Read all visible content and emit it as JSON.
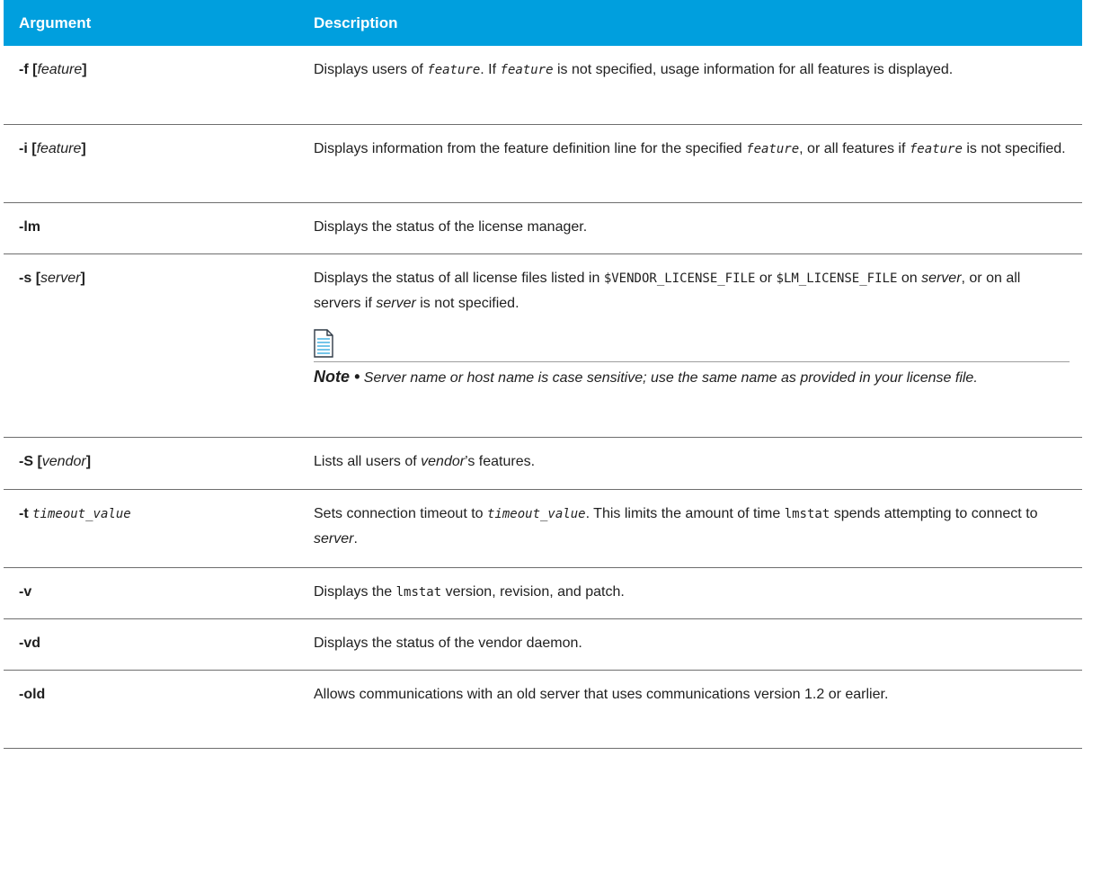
{
  "header": {
    "argument": "Argument",
    "description": "Description"
  },
  "rows": [
    {
      "arg_flag": "-f",
      "arg_open": "[",
      "arg_param": "feature",
      "arg_close": "]",
      "d1": "Displays users of ",
      "d2": "feature",
      "d3": ". If ",
      "d4": "feature",
      "d5": " is not specified, usage information for all features is displayed."
    },
    {
      "arg_flag": "-i",
      "arg_open": "[",
      "arg_param": "feature",
      "arg_close": "]",
      "d1": "Displays information from the feature definition line for the specified ",
      "d2": "feature",
      "d3": ", or all features if ",
      "d4": "feature",
      "d5": " is not specified."
    },
    {
      "arg_flag": "-lm",
      "d1": "Displays the status of the license manager."
    },
    {
      "arg_flag": "-s",
      "arg_open": "[",
      "arg_param": "server",
      "arg_close": "]",
      "d1": "Displays the status of all license files listed in ",
      "d2": "$VENDOR_LICENSE_FILE",
      "d3": " or ",
      "d4": "$LM_LICENSE_FILE",
      "d5": " on ",
      "d6": "server",
      "d7": ", or on all servers if ",
      "d8": "server",
      "d9": " is not specified.",
      "note_label": "Note •",
      "note_text": "Server name or host name is case sensitive; use the same name as provided in your license file."
    },
    {
      "arg_flag": "-S",
      "arg_open": "[",
      "arg_param": "vendor",
      "arg_close": "]",
      "d1": "Lists all users of ",
      "d2": "vendor",
      "d3": "’s features."
    },
    {
      "arg_flag": "-t",
      "arg_param": "timeout_value",
      "d1": "Sets connection timeout to ",
      "d2": "timeout_value",
      "d3": ". This limits the amount of time ",
      "d4": "lmstat",
      "d5": " spends attempting to connect to ",
      "d6": "server",
      "d7": "."
    },
    {
      "arg_flag": "-v",
      "d1": "Displays the ",
      "d2": "lmstat",
      "d3": " version, revision, and patch."
    },
    {
      "arg_flag": "-vd",
      "d1": "Displays the status of the vendor daemon."
    },
    {
      "arg_flag": "-old",
      "d1": "Allows communications with an old server that uses communications version 1.2 or earlier."
    }
  ],
  "icons": {
    "note": "document-note-icon"
  },
  "colors": {
    "header_bg": "#009fde",
    "header_text": "#ffffff",
    "rule": "#6e6e6e",
    "icon": "#2aa6dd"
  }
}
